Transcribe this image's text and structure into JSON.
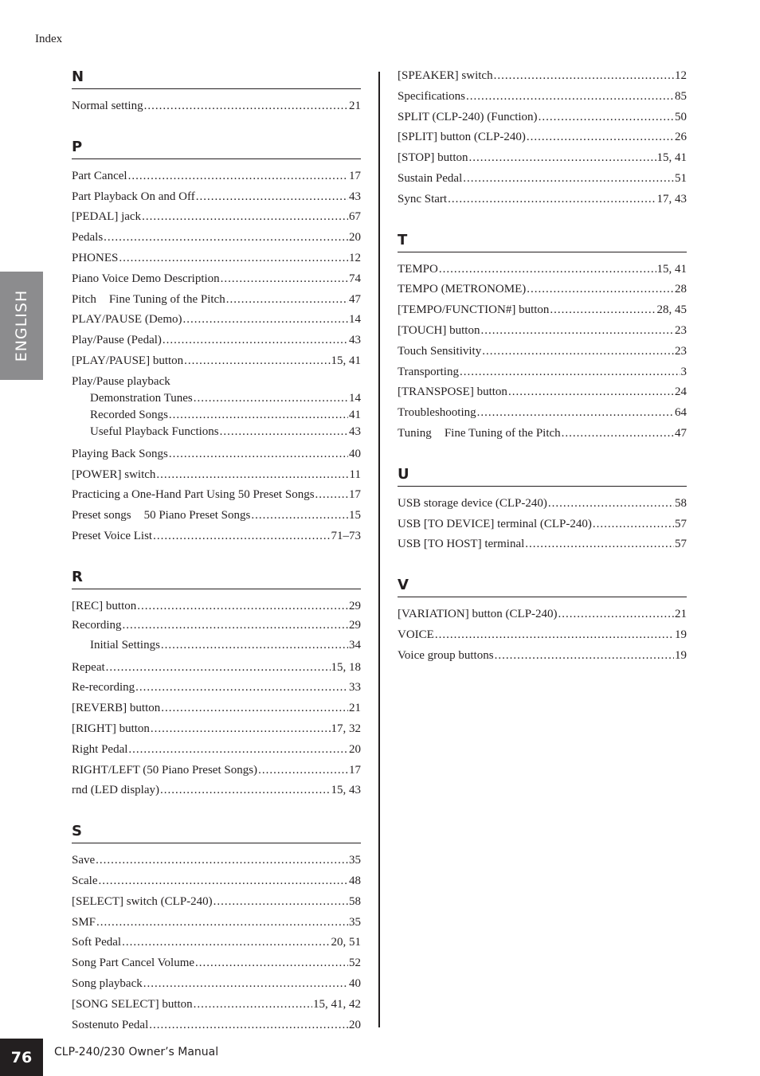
{
  "running_head": "Index",
  "language_tab": "ENGLISH",
  "footer": {
    "page_number": "76",
    "manual_title": "CLP-240/230 Owner’s Manual"
  },
  "left_column": [
    {
      "letter": "N",
      "entries": [
        {
          "label": "Normal setting",
          "pages": "21"
        }
      ]
    },
    {
      "letter": "P",
      "entries": [
        {
          "label": "Part Cancel",
          "pages": "17"
        },
        {
          "label": "Part Playback On and Off",
          "pages": "43"
        },
        {
          "label": "[PEDAL] jack",
          "pages": "67"
        },
        {
          "label": "Pedals",
          "pages": "20"
        },
        {
          "label": "PHONES",
          "pages": "12"
        },
        {
          "label": "Piano Voice Demo Description",
          "pages": "74"
        },
        {
          "label": "Pitch",
          "see": "Fine Tuning of the Pitch",
          "pages": "47"
        },
        {
          "label": "PLAY/PAUSE (Demo)",
          "pages": "14"
        },
        {
          "label": "Play/Pause (Pedal)",
          "pages": "43"
        },
        {
          "label": "[PLAY/PAUSE] button",
          "pages": "15, 41"
        },
        {
          "label": "Play/Pause playback",
          "pages": "",
          "subentries": [
            {
              "label": "Demonstration Tunes",
              "pages": "14"
            },
            {
              "label": "Recorded Songs",
              "pages": "41"
            },
            {
              "label": "Useful Playback Functions",
              "pages": "43"
            }
          ]
        },
        {
          "label": "Playing Back Songs",
          "pages": "40"
        },
        {
          "label": "[POWER] switch",
          "pages": "11"
        },
        {
          "label": "Practicing a One-Hand Part Using 50 Preset Songs",
          "pages": "17"
        },
        {
          "label": "Preset songs",
          "see": "50 Piano Preset Songs",
          "pages": "15"
        },
        {
          "label": "Preset Voice List",
          "pages": "71–73"
        }
      ]
    },
    {
      "letter": "R",
      "entries": [
        {
          "label": "[REC] button",
          "pages": "29"
        },
        {
          "label": "Recording",
          "pages": "29",
          "subentries": [
            {
              "label": "Initial Settings",
              "pages": "34"
            }
          ]
        },
        {
          "label": "Repeat",
          "pages": "15, 18"
        },
        {
          "label": "Re-recording",
          "pages": "33"
        },
        {
          "label": "[REVERB] button",
          "pages": "21"
        },
        {
          "label": "[RIGHT] button",
          "pages": "17, 32"
        },
        {
          "label": "Right Pedal",
          "pages": "20"
        },
        {
          "label": "RIGHT/LEFT (50 Piano Preset Songs)",
          "pages": "17"
        },
        {
          "label": "rnd (LED display)",
          "pages": "15, 43"
        }
      ]
    },
    {
      "letter": "S",
      "entries": [
        {
          "label": "Save",
          "pages": "35"
        },
        {
          "label": "Scale",
          "pages": "48"
        },
        {
          "label": "[SELECT] switch (CLP-240)",
          "pages": "58"
        },
        {
          "label": "SMF",
          "pages": "35"
        },
        {
          "label": "Soft Pedal",
          "pages": "20, 51"
        },
        {
          "label": "Song Part Cancel Volume",
          "pages": "52"
        },
        {
          "label": "Song playback",
          "pages": "40"
        },
        {
          "label": "[SONG SELECT] button",
          "pages": "15, 41, 42"
        },
        {
          "label": "Sostenuto Pedal",
          "pages": "20"
        }
      ]
    }
  ],
  "right_column": [
    {
      "letter": "",
      "entries": [
        {
          "label": "[SPEAKER] switch",
          "pages": "12"
        },
        {
          "label": "Specifications",
          "pages": "85"
        },
        {
          "label": "SPLIT (CLP-240) (Function)",
          "pages": "50"
        },
        {
          "label": "[SPLIT] button (CLP-240)",
          "pages": "26"
        },
        {
          "label": "[STOP] button",
          "pages": "15, 41"
        },
        {
          "label": "Sustain Pedal",
          "pages": "51"
        },
        {
          "label": "Sync Start",
          "pages": "17, 43"
        }
      ]
    },
    {
      "letter": "T",
      "entries": [
        {
          "label": "TEMPO",
          "pages": "15, 41"
        },
        {
          "label": "TEMPO (METRONOME)",
          "pages": "28"
        },
        {
          "label": "[TEMPO/FUNCTION#] button",
          "pages": "28, 45"
        },
        {
          "label": "[TOUCH] button",
          "pages": "23"
        },
        {
          "label": "Touch Sensitivity",
          "pages": "23"
        },
        {
          "label": "Transporting",
          "pages": "3"
        },
        {
          "label": "[TRANSPOSE] button",
          "pages": "24"
        },
        {
          "label": "Troubleshooting",
          "pages": "64"
        },
        {
          "label": "Tuning",
          "see": "Fine Tuning of the Pitch",
          "pages": "47"
        }
      ]
    },
    {
      "letter": "U",
      "entries": [
        {
          "label": "USB storage device (CLP-240)",
          "pages": "58"
        },
        {
          "label": "USB [TO DEVICE] terminal (CLP-240)",
          "pages": "57"
        },
        {
          "label": "USB [TO HOST] terminal",
          "pages": "57"
        }
      ]
    },
    {
      "letter": "V",
      "entries": [
        {
          "label": "[VARIATION] button (CLP-240)",
          "pages": "21"
        },
        {
          "label": "VOICE",
          "pages": "19"
        },
        {
          "label": "Voice group buttons",
          "pages": "19"
        }
      ]
    }
  ]
}
